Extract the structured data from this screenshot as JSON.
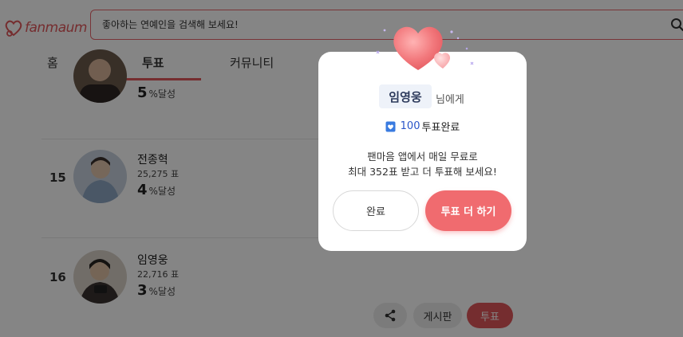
{
  "header": {
    "logo_text": "fanmaum",
    "search_placeholder": "좋아하는 연예인을 검색해 보세요!"
  },
  "tabs": [
    {
      "label": "홈",
      "active": false
    },
    {
      "label": "투표",
      "active": true
    },
    {
      "label": "커뮤니티",
      "active": false
    }
  ],
  "rows": [
    {
      "rank": "",
      "name": "",
      "votes": "",
      "percent": "5",
      "percent_unit": "%달성"
    },
    {
      "rank": "15",
      "name": "전종혁",
      "votes": "25,275 표",
      "percent": "4",
      "percent_unit": "%달성"
    },
    {
      "rank": "16",
      "name": "임영웅",
      "votes": "22,716 표",
      "percent": "3",
      "percent_unit": "%달성"
    }
  ],
  "actions": {
    "board_label": "게시판",
    "vote_label": "투표"
  },
  "modal": {
    "target_name": "임영웅",
    "target_suffix": "님에게",
    "vote_count": "100",
    "vote_result_label": "투표완료",
    "message_line1": "팬마음 앱에서 매일 무료로",
    "message_line2": "최대 352표 받고 더 투표해 보세요!",
    "done_label": "완료",
    "more_label": "투표 더 하기"
  },
  "colors": {
    "accent": "#e0575b",
    "accent_button": "#f06b6f",
    "vote_count": "#2a55c8",
    "overlay": "rgba(0,0,0,0.48)"
  },
  "icons": [
    "fanmaum-logo-icon",
    "search-icon",
    "share-icon",
    "ticket-icon",
    "heart-icon"
  ]
}
